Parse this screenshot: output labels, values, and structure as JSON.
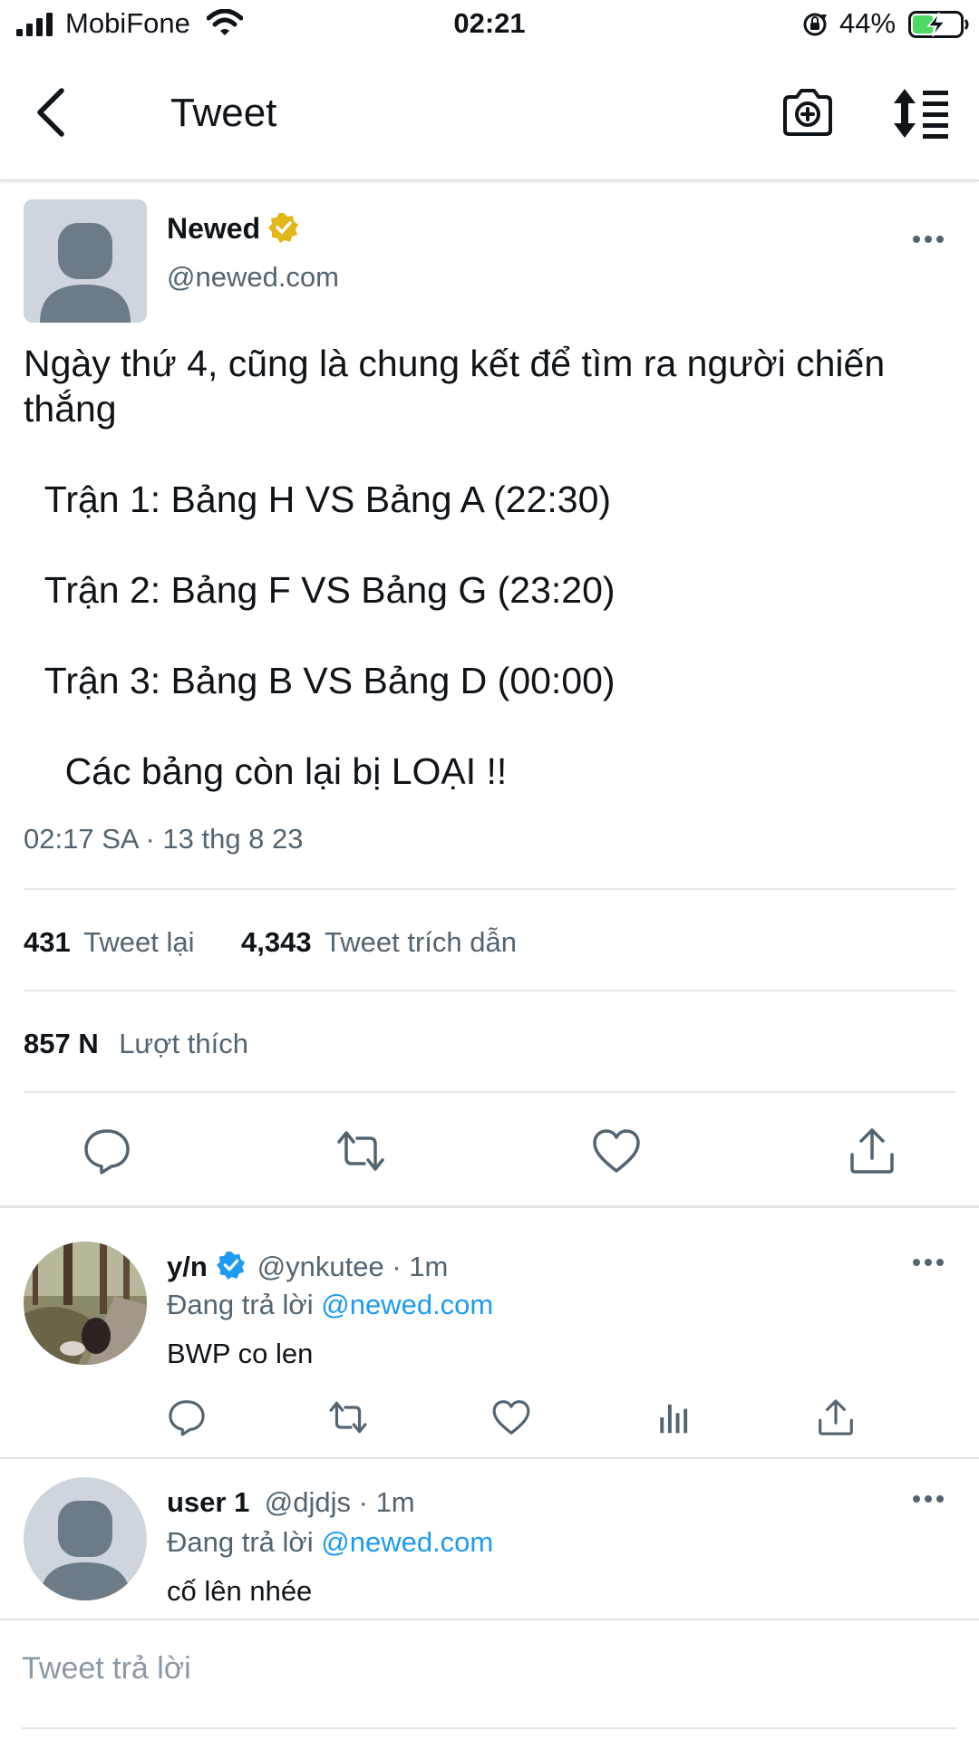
{
  "status_bar": {
    "carrier": "MobiFone",
    "time": "02:21",
    "battery_pct": "44%",
    "battery_level": 0.44
  },
  "nav": {
    "title": "Tweet"
  },
  "tweet": {
    "author_name": "Newed",
    "author_handle": "@newed.com",
    "body": "Ngày thứ 4, cũng là chung kết để tìm ra người chiến thắng\n\n  Trận 1: Bảng H VS Bảng A (22:30)\n\n  Trận 2: Bảng F VS Bảng G (23:20)\n\n  Trận 3: Bảng B VS Bảng D (00:00)\n\n    Các bảng còn lại bị LOẠI !!",
    "timestamp": "02:17 SA · 13 thg 8 23",
    "retweets_count": "431",
    "retweets_label": "Tweet lại",
    "quotes_count": "4,343",
    "quotes_label": "Tweet trích dẫn",
    "likes_count": "857 N",
    "likes_label": "Lượt thích"
  },
  "replies": [
    {
      "name": "y/n",
      "handle_time": "@ynkutee · 1m",
      "replying_prefix": "Đang trả lời",
      "replying_to": "@newed.com",
      "text": "BWP co len"
    },
    {
      "name": "user 1",
      "handle_time": "@djdjs · 1m",
      "replying_prefix": "Đang trả lời",
      "replying_to": "@newed.com",
      "text": "cố lên nhée"
    }
  ],
  "composer": {
    "placeholder": "Tweet trả lời"
  },
  "colors": {
    "accent": "#1d9bf0",
    "verified_gold": "#e2b719",
    "battery_green": "#4cd964"
  }
}
